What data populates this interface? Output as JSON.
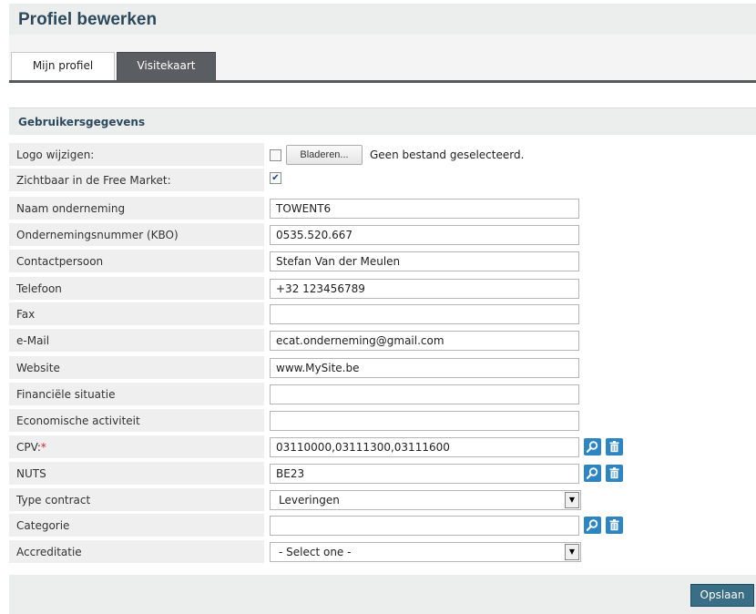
{
  "header": {
    "title": "Profiel bewerken"
  },
  "tabs": [
    {
      "label": "Mijn profiel"
    },
    {
      "label": "Visitekaart"
    }
  ],
  "section": {
    "title": "Gebruikersgegevens"
  },
  "logo": {
    "label": "Logo wijzigen:",
    "browse_label": "Bladeren...",
    "status": "Geen bestand geselecteerd."
  },
  "free_market": {
    "label": "Zichtbaar in de Free Market:",
    "checked": true,
    "check_glyph": "✔"
  },
  "fields": {
    "naam": {
      "label": "Naam onderneming",
      "value": "TOWENT6"
    },
    "kbo": {
      "label": "Ondernemingsnummer (KBO)",
      "value": "0535.520.667"
    },
    "contact": {
      "label": "Contactpersoon",
      "value": "Stefan Van der Meulen"
    },
    "telefoon": {
      "label": "Telefoon",
      "value": "+32 123456789"
    },
    "fax": {
      "label": "Fax",
      "value": ""
    },
    "email": {
      "label": "e-Mail",
      "value": "ecat.onderneming@gmail.com"
    },
    "website": {
      "label": "Website",
      "value": "www.MySite.be"
    },
    "financieel": {
      "label": "Financiële situatie",
      "value": ""
    },
    "economisch": {
      "label": "Economische activiteit",
      "value": ""
    },
    "cpv": {
      "label": "CPV:",
      "required_mark": "*",
      "value": "03110000,03111300,03111600"
    },
    "nuts": {
      "label": "NUTS",
      "value": "BE23"
    },
    "type_contract": {
      "label": "Type contract",
      "value": "Leveringen"
    },
    "categorie": {
      "label": "Categorie",
      "value": ""
    },
    "accreditatie": {
      "label": "Accreditatie",
      "value": "- Select one -"
    }
  },
  "footer": {
    "save_label": "Opslaan"
  },
  "colors": {
    "accent": "#2d86c2",
    "tab_active": "#5a5e62",
    "title": "#2d4a5d",
    "save": "#3a6d86"
  },
  "icons": {
    "search": "magnifier-icon",
    "delete": "trash-icon",
    "dropdown": "dropdown-arrow-icon"
  }
}
